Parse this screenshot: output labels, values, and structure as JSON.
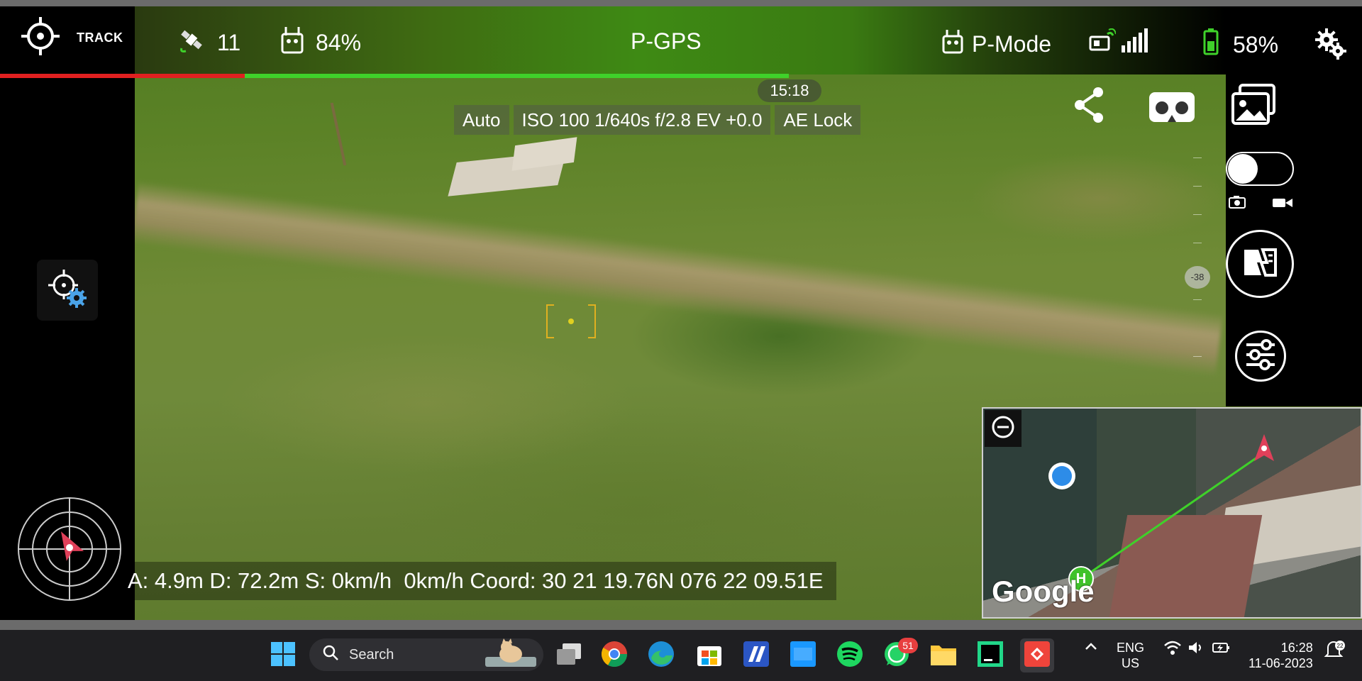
{
  "status": {
    "track_label": "TRACK",
    "satellites": "11",
    "rc_battery": "84%",
    "gps_mode": "P-GPS",
    "flight_mode": "P-Mode",
    "drone_battery": "58%",
    "progress_red_fraction": 0.31,
    "progress_green_fraction": 0.69
  },
  "camera": {
    "time": "15:18",
    "exposure": [
      "Auto",
      "ISO 100  1/640s  f/2.8  EV +0.0",
      "AE Lock"
    ],
    "gimbal_value": "-38"
  },
  "telemetry": {
    "text": "A: 4.9m D: 72.2m S: 0km/h  0km/h Coord: 30 21 19.76N 076 22 09.51E"
  },
  "map": {
    "logo": "Google",
    "home_label": "H"
  },
  "taskbar": {
    "search_placeholder": "Search",
    "whatsapp_badge": "51",
    "lang_line1": "ENG",
    "lang_line2": "US",
    "time": "16:28",
    "date": "11-06-2023",
    "notification_count": "22"
  },
  "colors": {
    "progress_red": "#e02020",
    "progress_green": "#3fd12a",
    "map_dot": "#2d8ce8",
    "home_marker": "#3fc22a",
    "focus_box": "#e0b020"
  }
}
